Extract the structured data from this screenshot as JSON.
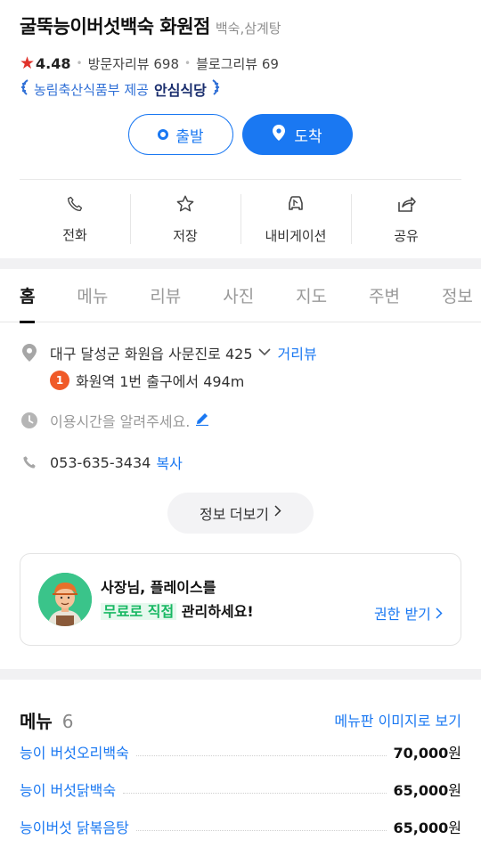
{
  "place": {
    "name": "굴뚝능이버섯백숙 화원점",
    "category": "백숙,삼계탕",
    "rating": "4.48",
    "visitor_reviews": "방문자리뷰 698",
    "blog_reviews": "블로그리뷰 69",
    "cert_text": "농림축산식품부 제공",
    "cert_badge": "안심식당"
  },
  "route": {
    "start_label": "출발",
    "arrive_label": "도착"
  },
  "actions": [
    {
      "label": "전화",
      "icon": "phone-icon"
    },
    {
      "label": "저장",
      "icon": "star-outline-icon"
    },
    {
      "label": "내비게이션",
      "icon": "car-icon"
    },
    {
      "label": "공유",
      "icon": "share-icon"
    }
  ],
  "tabs": [
    "홈",
    "메뉴",
    "리뷰",
    "사진",
    "지도",
    "주변",
    "정보"
  ],
  "info": {
    "address": "대구 달성군 화원읍 사문진로 425",
    "street_view": "거리뷰",
    "subway_num": "1",
    "subway_text": "화원역 1번 출구에서 494m",
    "hours_prompt": "이용시간을 알려주세요.",
    "phone": "053-635-3434",
    "copy_label": "복사",
    "more_label": "정보 더보기"
  },
  "owner_card": {
    "line1": "사장님, 플레이스를",
    "highlight": "무료로 직접",
    "line2_rest": "관리하세요!",
    "cta": "권한 받기"
  },
  "menu": {
    "title": "메뉴",
    "count": "6",
    "image_link": "메뉴판 이미지로 보기",
    "items": [
      {
        "name": "능이 버섯오리백숙",
        "price": "70,000",
        "unit": "원"
      },
      {
        "name": "능이 버섯닭백숙",
        "price": "65,000",
        "unit": "원"
      },
      {
        "name": "능이버섯 닭볶음탕",
        "price": "65,000",
        "unit": "원"
      }
    ]
  },
  "colors": {
    "accent": "#1a78f2",
    "star": "#e0322b",
    "badge": "#f05a28",
    "owner_green": "#19b864"
  }
}
